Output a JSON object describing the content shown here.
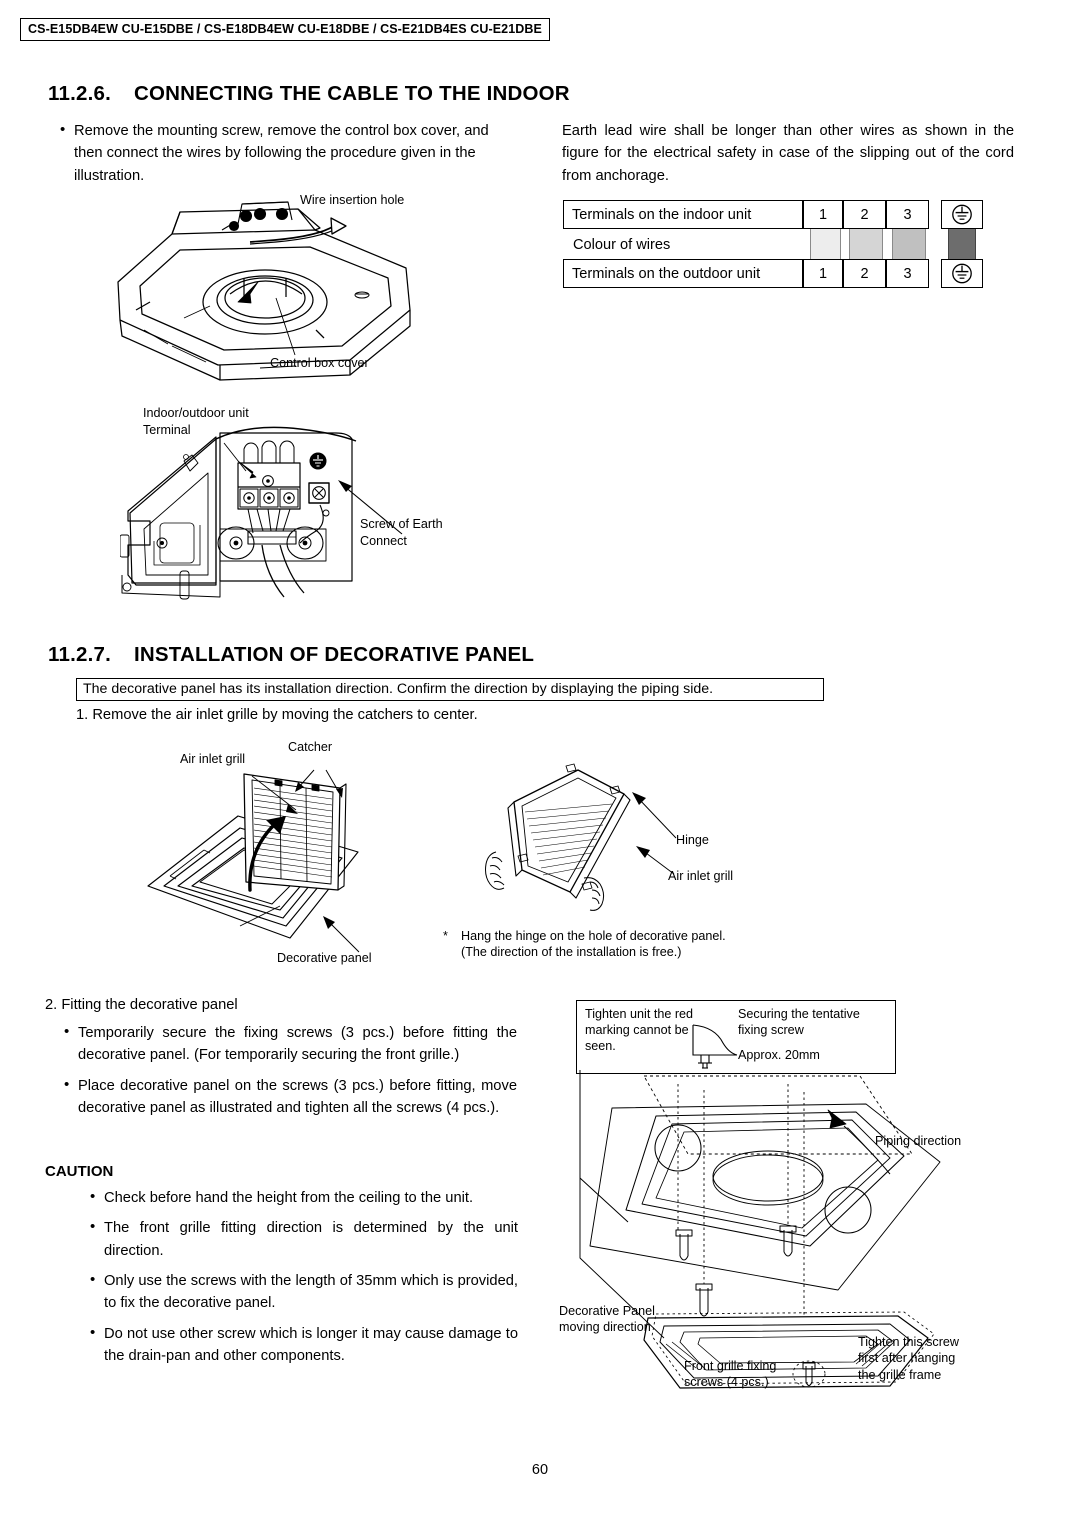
{
  "header": {
    "models": "CS-E15DB4EW CU-E15DBE / CS-E18DB4EW CU-E18DBE / CS-E21DB4ES CU-E21DBE"
  },
  "section_1": {
    "number": "11.2.6.",
    "title": "CONNECTING THE CABLE TO THE INDOOR",
    "left_bullet": "Remove the mounting screw, remove the control box cover, and then connect the wires by following the procedure given in the illustration.",
    "right_paragraph": "Earth lead wire shall be longer than other wires as shown in the figure for the electrical safety in case of the slipping out of the cord from anchorage.",
    "table": {
      "row_indoor_label": "Terminals on the indoor unit",
      "row_colour_label": "Colour of wires",
      "row_outdoor_label": "Terminals on the outdoor unit",
      "terminals_indoor": [
        "1",
        "2",
        "3"
      ],
      "terminals_outdoor": [
        "1",
        "2",
        "3"
      ],
      "earth_symbol": "earth-ground-symbol",
      "wire_colors": [
        "#ededed",
        "#d5d5d5",
        "#c0c0c0"
      ],
      "earth_band_color": "#6d6d6d"
    },
    "figure_top": {
      "label_wire_hole": "Wire insertion hole",
      "label_control_box": "Control box cover"
    },
    "figure_bottom": {
      "label_terminal_line1": "Indoor/outdoor unit",
      "label_terminal_line2": "Terminal",
      "label_earth_line1": "Screw of Earth",
      "label_earth_line2": "Connect"
    }
  },
  "section_2": {
    "number": "11.2.7.",
    "title": "INSTALLATION OF DECORATIVE PANEL",
    "note_box": "The decorative panel has its installation direction. Confirm the direction by displaying the piping side.",
    "step_1": "1. Remove the air inlet grille by moving the catchers to center.",
    "figure_left": {
      "label_air_inlet": "Air inlet grill",
      "label_catcher": "Catcher",
      "label_decorative_panel": "Decorative panel"
    },
    "figure_right": {
      "label_hinge": "Hinge",
      "label_air_inlet": "Air inlet grill",
      "note_line1": "Hang the hinge on the hole of decorative panel.",
      "note_line2": "(The direction of the installation is free.)",
      "note_marker": "*"
    },
    "step_2_title": "2. Fitting the decorative panel",
    "step_2_bullets": [
      "Temporarily secure the fixing screws (3 pcs.) before fitting the decorative panel. (For temporarily securing the front grille.)",
      "Place decorative panel on the screws (3 pcs.) before fitting, move decorative panel as illustrated and tighten all the screws (4 pcs.)."
    ],
    "caution_title": "CAUTION",
    "caution_bullets": [
      "Check before hand the height from the ceiling to the unit.",
      "The front grille fitting direction is determined by the unit direction.",
      "Only use the screws with the length of 35mm which is provided, to fix the decorative panel.",
      "Do not use other screw which is longer it may cause damage to the drain-pan and other components."
    ],
    "figure_assembly": {
      "callout_left_line1": "Tighten unit the red",
      "callout_left_line2": "marking cannot be",
      "callout_left_line3": "seen.",
      "callout_right_line1": "Securing the tentative",
      "callout_right_line2": "fixing screw",
      "callout_dimension": "Approx. 20mm",
      "label_piping": "Piping direction",
      "label_panel_move_line1": "Decorative Panel",
      "label_panel_move_line2": "moving direction",
      "label_front_screws_line1": "Front grille fixing",
      "label_front_screws_line2": "screws (4 pcs.)",
      "label_tighten_line1": "Tighten this screw",
      "label_tighten_line2": "first after hanging",
      "label_tighten_line3": "the grille frame"
    }
  },
  "footer": {
    "page_number": "60"
  }
}
